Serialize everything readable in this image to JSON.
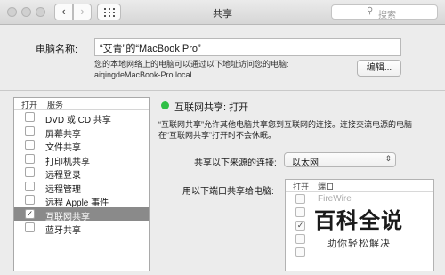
{
  "window": {
    "title": "共享",
    "search_placeholder": "搜索",
    "grid_icon": "show-all-grid-icon"
  },
  "computer": {
    "name_label": "电脑名称:",
    "name_value": "“艾青”的“MacBook Pro”",
    "hint_line1": "您的本地网络上的电脑可以通过以下地址访问您的电脑:",
    "hint_line2": "aiqingdeMacBook-Pro.local",
    "edit_button": "编辑..."
  },
  "services": {
    "header_on": "打开",
    "header_service": "服务",
    "items": [
      {
        "label": "DVD 或 CD 共享",
        "checked": false,
        "selected": false
      },
      {
        "label": "屏幕共享",
        "checked": false,
        "selected": false
      },
      {
        "label": "文件共享",
        "checked": false,
        "selected": false
      },
      {
        "label": "打印机共享",
        "checked": false,
        "selected": false
      },
      {
        "label": "远程登录",
        "checked": false,
        "selected": false
      },
      {
        "label": "远程管理",
        "checked": false,
        "selected": false
      },
      {
        "label": "远程 Apple 事件",
        "checked": false,
        "selected": false
      },
      {
        "label": "互联网共享",
        "checked": true,
        "selected": true
      },
      {
        "label": "蓝牙共享",
        "checked": false,
        "selected": false
      }
    ]
  },
  "detail": {
    "status_title": "互联网共享: 打开",
    "status_color": "#2fbf45",
    "description": "“互联网共享”允许其他电脑共享您到互联网的连接。连接交流电源的电脑在“互联网共享”打开时不会休眠。",
    "share_from_label": "共享以下来源的连接:",
    "share_from_value": "以太网",
    "to_label": "用以下端口共享给电脑:",
    "ports_header_on": "打开",
    "ports_header_port": "端口",
    "ports": [
      {
        "label": "FireWire",
        "checked": false
      },
      {
        "label": "",
        "checked": false
      },
      {
        "label": "",
        "checked": true
      },
      {
        "label": "",
        "checked": false
      },
      {
        "label": "",
        "checked": false
      }
    ]
  },
  "watermark": {
    "title": "百科全说",
    "subtitle": "助你轻松解决"
  }
}
